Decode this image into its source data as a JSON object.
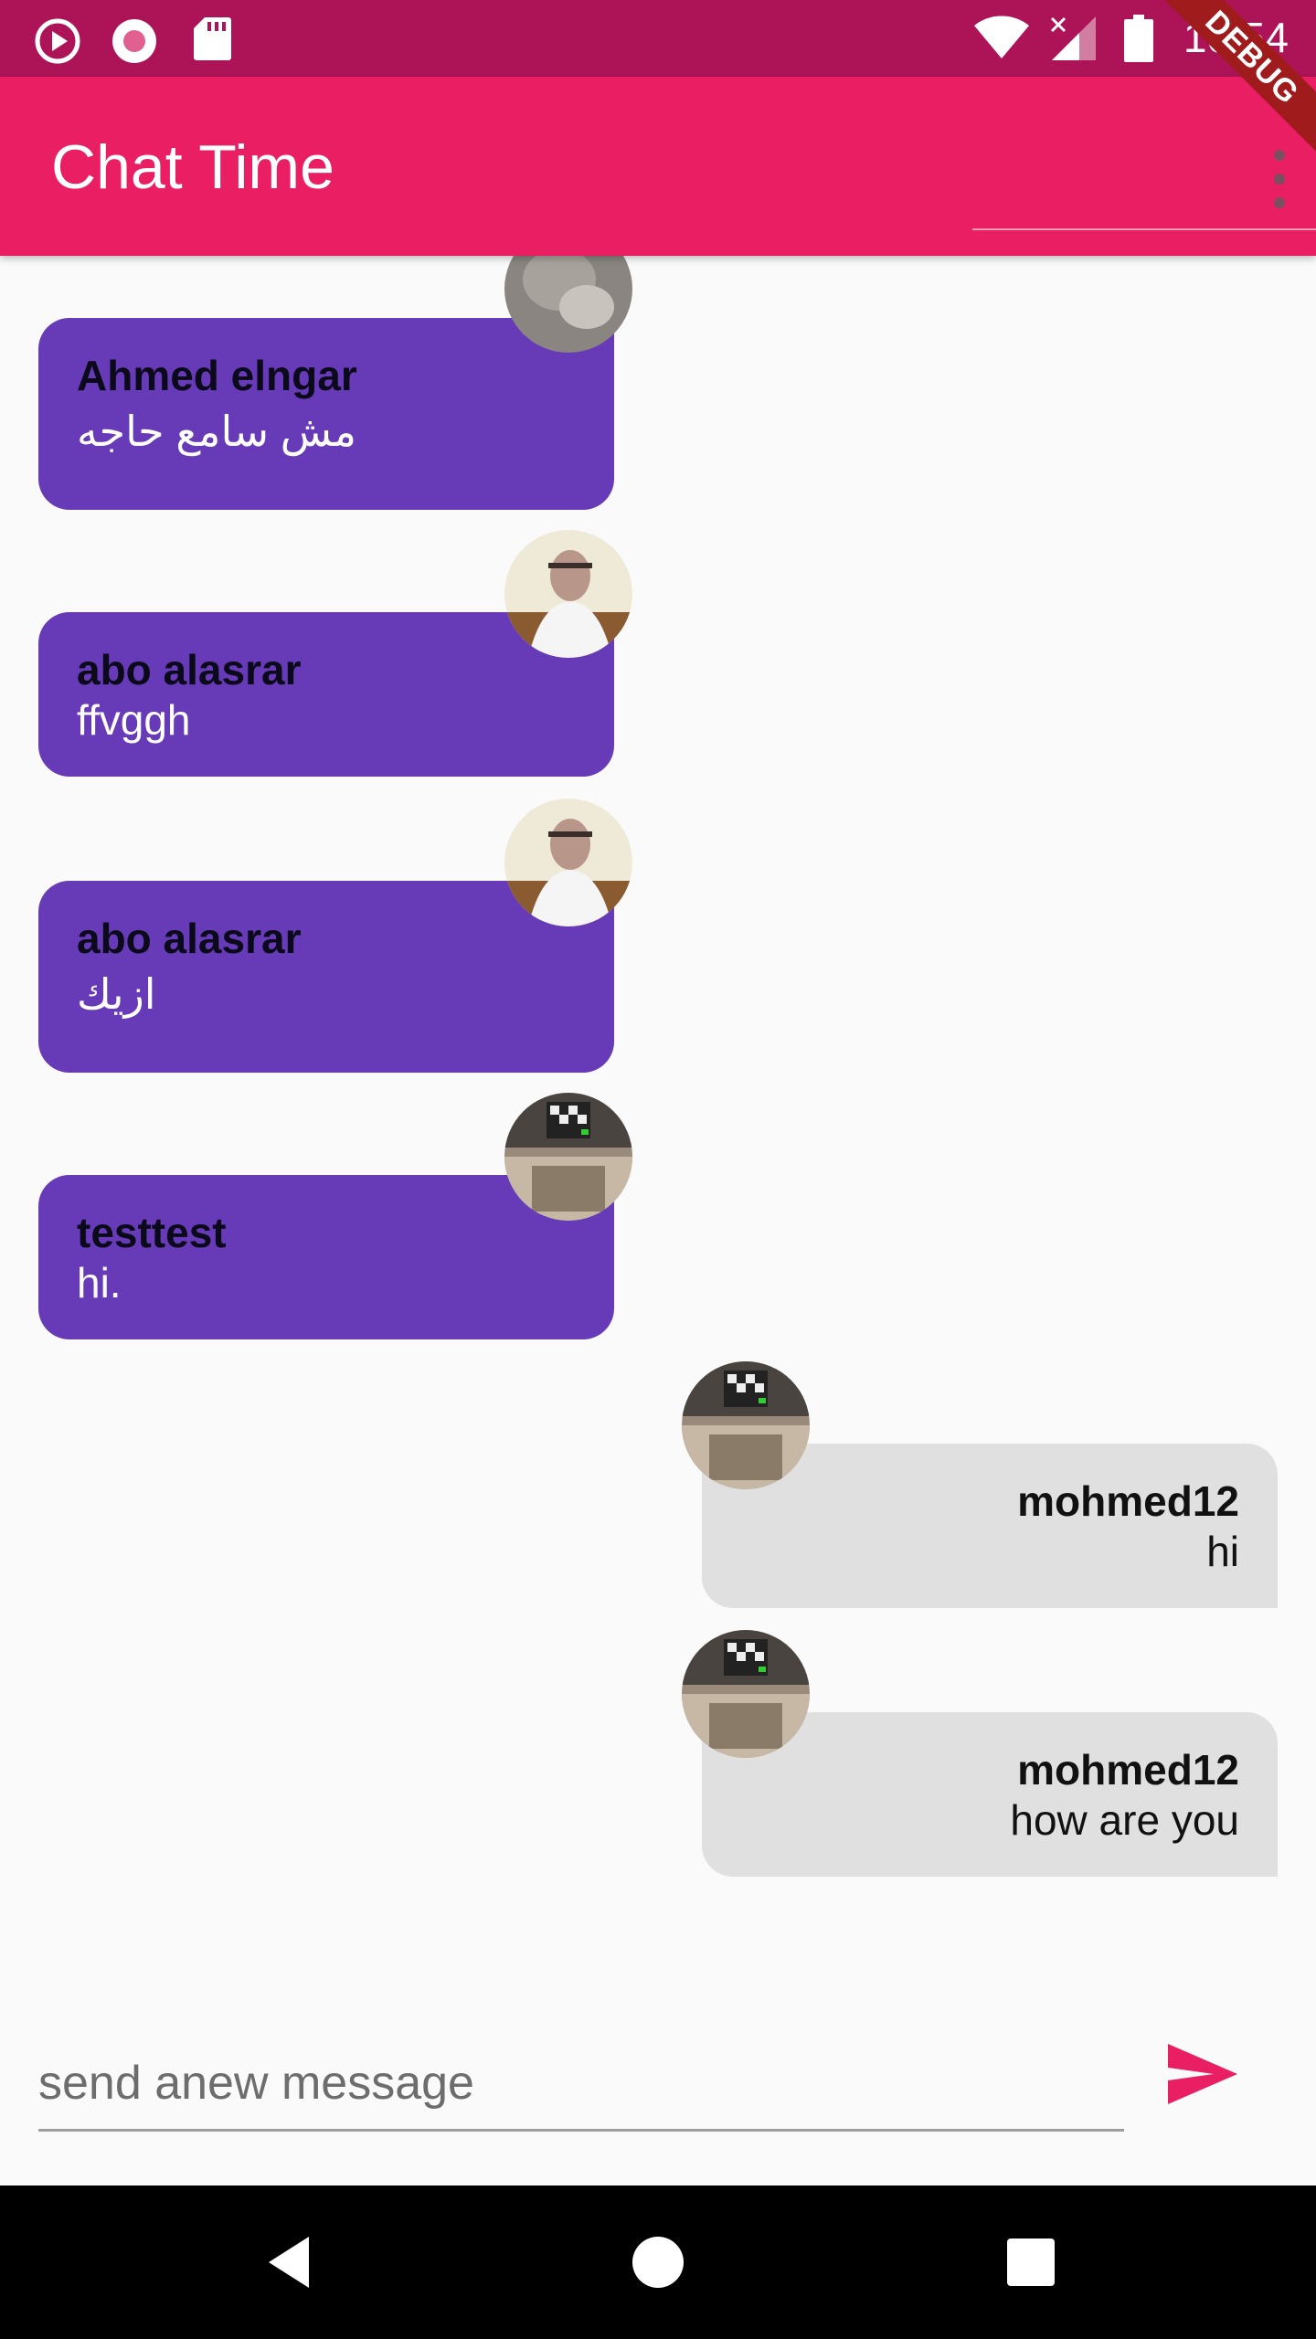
{
  "status_bar": {
    "time": "10:54",
    "icons": [
      "play-circle-icon",
      "record-icon",
      "sd-card-icon",
      "wifi-icon",
      "signal-icon",
      "battery-icon"
    ]
  },
  "app_bar": {
    "title": "Chat Time",
    "debug_label": "DEBUG",
    "menu_icon": "more-vert-icon"
  },
  "messages": [
    {
      "sender": "Ahmed elngar",
      "text": "مش سامع حاجه",
      "direction": "incoming",
      "avatar": "avatar-photo-1"
    },
    {
      "sender": "abo alasrar",
      "text": "ffvggh",
      "direction": "incoming",
      "avatar": "avatar-photo-2"
    },
    {
      "sender": "abo alasrar",
      "text": "ازيك",
      "direction": "incoming",
      "avatar": "avatar-photo-2"
    },
    {
      "sender": "testtest",
      "text": "hi.",
      "direction": "incoming",
      "avatar": "avatar-photo-3"
    },
    {
      "sender": "mohmed12",
      "text": "hi",
      "direction": "outgoing",
      "avatar": "avatar-photo-3"
    },
    {
      "sender": "mohmed12",
      "text": "how are you",
      "direction": "outgoing",
      "avatar": "avatar-photo-3"
    }
  ],
  "composer": {
    "placeholder": "send anew message",
    "value": "",
    "send_icon": "send-icon"
  },
  "nav_bar": {
    "icons": [
      "back-icon",
      "home-icon",
      "recents-icon"
    ]
  },
  "colors": {
    "status_bar": "#ad1457",
    "app_bar": "#e91e63",
    "incoming_bubble": "#673ab7",
    "outgoing_bubble": "#e0e0e0",
    "send_icon": "#e91e63"
  }
}
